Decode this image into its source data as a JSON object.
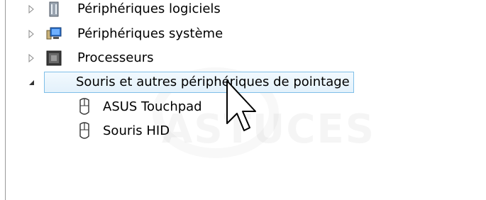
{
  "tree": {
    "items": [
      {
        "label": "Périphériques logiciels",
        "expander": "collapsed",
        "icon": "software-devices-icon"
      },
      {
        "label": "Périphériques système",
        "expander": "collapsed",
        "icon": "system-devices-icon"
      },
      {
        "label": "Processeurs",
        "expander": "collapsed",
        "icon": "processor-icon"
      },
      {
        "label": "Souris et autres périphériques de pointage",
        "expander": "expanded",
        "icon": "mouse-icon",
        "selected": true
      },
      {
        "label": "ASUS Touchpad",
        "expander": "none",
        "icon": "mouse-icon"
      },
      {
        "label": "Souris HID",
        "expander": "none",
        "icon": "mouse-icon"
      }
    ]
  },
  "watermark": {
    "text": "ASTUCES"
  },
  "colors": {
    "selection_border": "#7fbfe8",
    "selection_fill": "#e3f1fb",
    "expander": "#6d6d6d"
  }
}
